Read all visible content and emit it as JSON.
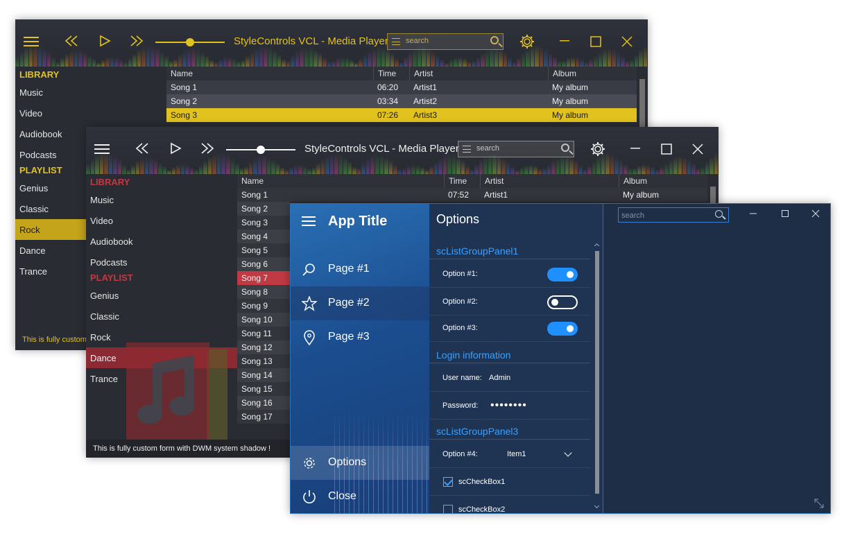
{
  "player_yellow": {
    "title": "StyleControls VCL - Media Player",
    "search_placeholder": "search",
    "accent": "#e2c21e",
    "volume_level": 0.5,
    "library_header": "LIBRARY",
    "library": [
      "Music",
      "Video",
      "Audiobook",
      "Podcasts"
    ],
    "playlist_header": "PLAYLIST",
    "playlist": [
      "Genius",
      "Classic",
      "Rock",
      "Dance",
      "Trance"
    ],
    "selected_playlist": "Rock",
    "columns": [
      "Name",
      "Time",
      "Artist",
      "Album"
    ],
    "tracks": [
      {
        "name": "Song 1",
        "time": "06:20",
        "artist": "Artist1",
        "album": "My album"
      },
      {
        "name": "Song 2",
        "time": "03:34",
        "artist": "Artist2",
        "album": "My album"
      },
      {
        "name": "Song 3",
        "time": "07:26",
        "artist": "Artist3",
        "album": "My album"
      }
    ],
    "selected_track": "Song 3",
    "status": "This is fully custom"
  },
  "player_red": {
    "title": "StyleControls VCL - Media Player",
    "search_placeholder": "search",
    "accent": "#c03a44",
    "volume_level": 0.5,
    "library_header": "LIBRARY",
    "library": [
      "Music",
      "Video",
      "Audiobook",
      "Podcasts"
    ],
    "playlist_header": "PLAYLIST",
    "playlist": [
      "Genius",
      "Classic",
      "Rock",
      "Dance",
      "Trance"
    ],
    "selected_playlist": "Dance",
    "columns": [
      "Name",
      "Time",
      "Artist",
      "Album"
    ],
    "tracks": [
      {
        "name": "Song 1",
        "time": "07:52",
        "artist": "Artist1",
        "album": "My album"
      },
      {
        "name": "Song 2"
      },
      {
        "name": "Song 3"
      },
      {
        "name": "Song 4"
      },
      {
        "name": "Song 5"
      },
      {
        "name": "Song 6"
      },
      {
        "name": "Song 7"
      },
      {
        "name": "Song 8"
      },
      {
        "name": "Song 9"
      },
      {
        "name": "Song 10"
      },
      {
        "name": "Song 11"
      },
      {
        "name": "Song 12"
      },
      {
        "name": "Song 13"
      },
      {
        "name": "Song 14"
      },
      {
        "name": "Song 15"
      },
      {
        "name": "Song 16"
      },
      {
        "name": "Song 17"
      }
    ],
    "selected_track": "Song 7",
    "status": "This is fully custom form with DWM system shadow !"
  },
  "app": {
    "title": "App Title",
    "nav": [
      {
        "label": "Page #1",
        "icon": "search-icon"
      },
      {
        "label": "Page #2",
        "icon": "star-icon"
      },
      {
        "label": "Page #3",
        "icon": "location-pin-icon"
      }
    ],
    "selected_nav": "Page #2",
    "nav_bottom": [
      {
        "label": "Options",
        "icon": "gear-icon"
      },
      {
        "label": "Close",
        "icon": "power-icon"
      }
    ],
    "options_title": "Options",
    "group1": "scListGroupPanel1",
    "option1_label": "Option #1:",
    "option1_on": true,
    "option2_label": "Option #2:",
    "option2_on": false,
    "option3_label": "Option #3:",
    "option3_on": true,
    "group2": "Login information",
    "username_label": "User name:",
    "username_value": "Admin",
    "password_label": "Password:",
    "password_value": "••••••••",
    "group3": "scListGroupPanel3",
    "option4_label": "Option #4:",
    "option4_value": "Item1",
    "checkbox1_label": "scCheckBox1",
    "checkbox1_checked": true,
    "checkbox2_label": "scCheckBox2",
    "checkbox2_checked": false,
    "search_placeholder": "search",
    "accent": "#1e90ff"
  }
}
